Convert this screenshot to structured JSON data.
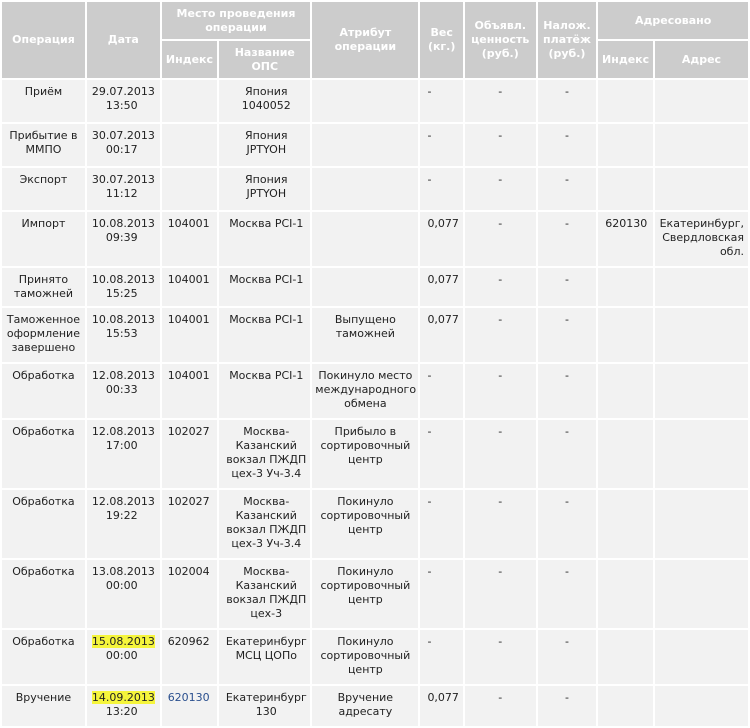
{
  "colors": {
    "header_bg": "#cccccc",
    "header_text": "#ffffff",
    "row_bg": "#f2f2f2",
    "highlight": "#f5f53c",
    "link": "#2a4f8e"
  },
  "headers": {
    "operation": "Операция",
    "date": "Дата",
    "place_group": "Место проведения\nоперации",
    "place_index": "Индекс",
    "place_name": "Название\nОПС",
    "attribute": "Атрибут\nоперации",
    "weight": "Вес\n(кг.)",
    "declared": "Объявл.\nценность\n(руб.)",
    "cod": "Налож.\nплатёж\n(руб.)",
    "addressed_group": "Адресовано",
    "addressed_index": "Индекс",
    "addressed_address": "Адрес"
  },
  "rows": [
    {
      "operation": "Приём",
      "date": "29.07.2013",
      "time": "13:50",
      "index": "",
      "ops_name": "Япония\n1040052",
      "attribute": "",
      "weight": "-",
      "declared": "-",
      "cod": "-",
      "dest_index": "",
      "dest_address": ""
    },
    {
      "operation": "Прибытие в\nММПО",
      "date": "30.07.2013",
      "time": "00:17",
      "index": "",
      "ops_name": "Япония\nJPTYOH",
      "attribute": "",
      "weight": "-",
      "declared": "-",
      "cod": "-",
      "dest_index": "",
      "dest_address": ""
    },
    {
      "operation": "Экспорт",
      "date": "30.07.2013",
      "time": "11:12",
      "index": "",
      "ops_name": "Япония\nJPTYOH",
      "attribute": "",
      "weight": "-",
      "declared": "-",
      "cod": "-",
      "dest_index": "",
      "dest_address": ""
    },
    {
      "operation": "Импорт",
      "date": "10.08.2013",
      "time": "09:39",
      "index": "104001",
      "ops_name": "Москва PCI-1",
      "attribute": "",
      "weight": "0,077",
      "declared": "-",
      "cod": "-",
      "dest_index": "620130",
      "dest_address": "Екатеринбург,\nСвердловская\nобл."
    },
    {
      "operation": "Принято\nтаможней",
      "date": "10.08.2013",
      "time": "15:25",
      "index": "104001",
      "ops_name": "Москва PCI-1",
      "attribute": "",
      "weight": "0,077",
      "declared": "-",
      "cod": "-",
      "dest_index": "",
      "dest_address": ""
    },
    {
      "operation": "Таможенное\nоформление\nзавершено",
      "date": "10.08.2013",
      "time": "15:53",
      "index": "104001",
      "ops_name": "Москва PCI-1",
      "attribute": "Выпущено\nтаможней",
      "weight": "0,077",
      "declared": "-",
      "cod": "-",
      "dest_index": "",
      "dest_address": ""
    },
    {
      "operation": "Обработка",
      "date": "12.08.2013",
      "time": "00:33",
      "index": "104001",
      "ops_name": "Москва PCI-1",
      "attribute": "Покинуло место\nмеждународного\nобмена",
      "weight": "-",
      "declared": "-",
      "cod": "-",
      "dest_index": "",
      "dest_address": ""
    },
    {
      "operation": "Обработка",
      "date": "12.08.2013",
      "time": "17:00",
      "index": "102027",
      "ops_name": "Москва-\nКазанский\nвокзал ПЖДП\nцех-3 Уч-3.4",
      "attribute": "Прибыло в\nсортировочный\nцентр",
      "weight": "-",
      "declared": "-",
      "cod": "-",
      "dest_index": "",
      "dest_address": ""
    },
    {
      "operation": "Обработка",
      "date": "12.08.2013",
      "time": "19:22",
      "index": "102027",
      "ops_name": "Москва-\nКазанский\nвокзал ПЖДП\nцех-3 Уч-3.4",
      "attribute": "Покинуло\nсортировочный\nцентр",
      "weight": "-",
      "declared": "-",
      "cod": "-",
      "dest_index": "",
      "dest_address": ""
    },
    {
      "operation": "Обработка",
      "date": "13.08.2013",
      "time": "00:00",
      "index": "102004",
      "ops_name": "Москва-\nКазанский\nвокзал ПЖДП\nцех-3",
      "attribute": "Покинуло\nсортировочный\nцентр",
      "weight": "-",
      "declared": "-",
      "cod": "-",
      "dest_index": "",
      "dest_address": ""
    },
    {
      "operation": "Обработка",
      "date": "15.08.2013",
      "time": "00:00",
      "index": "620962",
      "ops_name": "Екатеринбург\nМСЦ ЦОПо",
      "attribute": "Покинуло\nсортировочный\nцентр",
      "weight": "-",
      "declared": "-",
      "cod": "-",
      "dest_index": "",
      "dest_address": "",
      "date_highlight": true
    },
    {
      "operation": "Вручение",
      "date": "14.09.2013",
      "time": "13:20",
      "index": "620130",
      "ops_name": "Екатеринбург\n130",
      "attribute": "Вручение\nадресату",
      "weight": "0,077",
      "declared": "-",
      "cod": "-",
      "dest_index": "",
      "dest_address": "",
      "date_highlight": true,
      "index_link": true
    }
  ]
}
